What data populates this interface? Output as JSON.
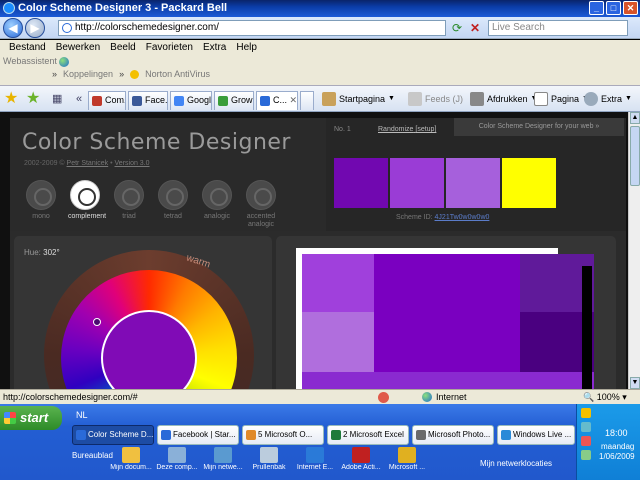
{
  "window": {
    "title": "Color Scheme Designer 3 - Packard Bell"
  },
  "address": {
    "url": "http://colorschemedesigner.com/",
    "search_placeholder": "Live Search"
  },
  "menu": [
    "Bestand",
    "Bewerken",
    "Beeld",
    "Favorieten",
    "Extra",
    "Help"
  ],
  "links": {
    "webassistent": "Webassistent",
    "koppelingen": "Koppelingen",
    "antivirus": "Norton AntiVirus"
  },
  "tabs": [
    {
      "label": "Com...",
      "color": "#c0392b"
    },
    {
      "label": "Face...",
      "color": "#3b5998"
    },
    {
      "label": "Googl...",
      "color": "#4285f4"
    },
    {
      "label": "Grow ...",
      "color": "#3a9d3a"
    },
    {
      "label": "C...",
      "color": "#2a6ad8",
      "active": true
    }
  ],
  "toolbar": {
    "home": "Startpagina",
    "feeds": "Feeds (J)",
    "print": "Afdrukken",
    "page": "Pagina",
    "tools": "Extra"
  },
  "app": {
    "title": "Color Scheme Designer",
    "sub_years": "2002-2009 ©",
    "sub_author": "Petr Stanicek",
    "sub_version": "Version 3.0",
    "modes": [
      {
        "label": "mono"
      },
      {
        "label": "complement",
        "active": true
      },
      {
        "label": "triad"
      },
      {
        "label": "tetrad"
      },
      {
        "label": "analogic"
      },
      {
        "label": "accented analogic"
      }
    ],
    "header_no": "No. 1",
    "randomize": "Randomize",
    "setup": "[setup]",
    "for_web": "Color Scheme Designer for your web »",
    "scheme_id_label": "Scheme ID:",
    "scheme_id": "4J21Tw0w0w0w0",
    "hue_label": "Hue:",
    "hue_value": "302°",
    "warm": "warm",
    "swatches": [
      "#7108b0",
      "#9a3cd6",
      "#a660dc",
      "#ffff00"
    ],
    "preview_colors": {
      "a": "#a040dc",
      "b": "#7a00c0",
      "c": "#601a9a",
      "d": "#b06edd",
      "e": "#4a0080",
      "f": "#8a2ad0"
    }
  },
  "status": {
    "url": "http://colorschemedesigner.com/#",
    "zone": "Internet",
    "zoom": "100%"
  },
  "taskbar": {
    "start": "start",
    "lang": "NL",
    "tasks": [
      {
        "label": "Color Scheme D...",
        "active": true,
        "color": "#2a6ad8"
      },
      {
        "label": "Facebook | Star...",
        "color": "#2a6ad8"
      },
      {
        "label": "5 Microsoft O...",
        "color": "#e08a2a"
      },
      {
        "label": "2 Microsoft Excel",
        "color": "#1f7a3a"
      },
      {
        "label": "Microsoft Photo...",
        "color": "#6a6a6a"
      },
      {
        "label": "Windows Live ...",
        "color": "#2a8ad8"
      }
    ],
    "desktop_label": "Bureaublad",
    "desktop_icons": [
      {
        "label": "Mijn docum...",
        "color": "#f0c040"
      },
      {
        "label": "Deze comp...",
        "color": "#8ab0d8"
      },
      {
        "label": "Mijn netwe...",
        "color": "#5a9ad0"
      },
      {
        "label": "Prullenbak",
        "color": "#bcd"
      },
      {
        "label": "Internet E...",
        "color": "#2a7ad8"
      },
      {
        "label": "Adobe Acti...",
        "color": "#c02020"
      },
      {
        "label": "Microsoft ...",
        "color": "#e0b020"
      }
    ],
    "network": "Mijn netwerklocaties",
    "time": "18:00",
    "day": "maandag",
    "date": "1/06/2009"
  }
}
